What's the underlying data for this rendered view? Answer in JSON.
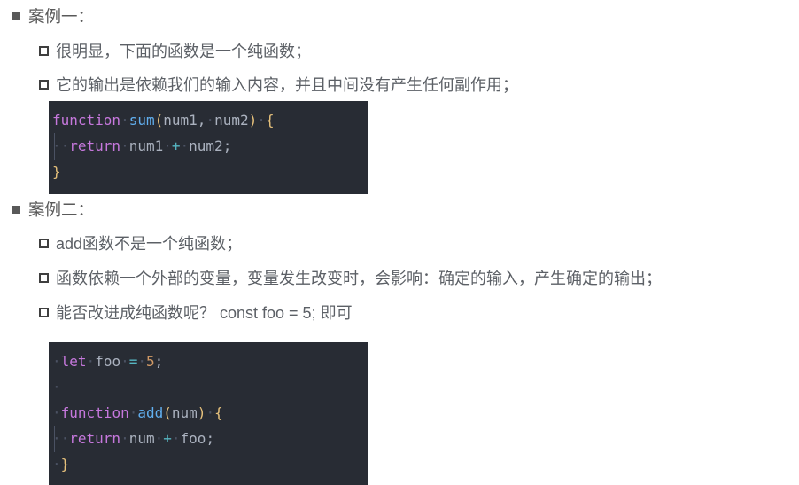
{
  "slide": {
    "background_color": "#ffffff",
    "text_color": "#595959",
    "sections": [
      {
        "heading": "案例一：",
        "bullets": [
          "很明显，下面的函数是一个纯函数；",
          "它的输出是依赖我们的输入内容，并且中间没有产生任何副作用；"
        ]
      },
      {
        "heading": "案例二：",
        "bullets": [
          "add函数不是一个纯函数；",
          "函数依赖一个外部的变量，变量发生改变时，会影响：确定的输入，产生确定的输出；",
          "能否改进成纯函数呢？ const foo = 5; 即可"
        ]
      }
    ]
  },
  "code_blocks": [
    {
      "language": "javascript",
      "background_color": "#282c34",
      "code": "function sum(num1, num2) {\n  return num1 + num2;\n}",
      "lines": [
        "function sum(num1, num2) {",
        "  return num1 + num2;",
        "}"
      ]
    },
    {
      "language": "javascript",
      "background_color": "#282c34",
      "code": "let foo = 5;\n\nfunction add(num) {\n  return num + foo;\n}",
      "lines": [
        "let foo = 5;",
        "",
        "function add(num) {",
        "  return num + foo;",
        "}"
      ]
    }
  ],
  "syntax_colors": {
    "keyword": "#c678dd",
    "function_name": "#61afef",
    "bracket": "#e5c07b",
    "identifier": "#abb2bf",
    "operator": "#56b6c2",
    "number": "#d19a66",
    "whitespace_marker": "#4b5263"
  },
  "tokens": {
    "kw_function": "function",
    "kw_return": "return",
    "kw_let": "let",
    "fn_sum": "sum",
    "fn_add": "add",
    "id_num1": "num1",
    "id_num2": "num2",
    "id_num": "num",
    "id_foo": "foo",
    "op_plus": "+",
    "op_eq": "=",
    "num_5": "5",
    "paren_open": "(",
    "paren_close": ")",
    "brace_open": "{",
    "brace_close": "}",
    "comma": ",",
    "semi": ";",
    "dot": "·",
    "dot2": "··"
  }
}
